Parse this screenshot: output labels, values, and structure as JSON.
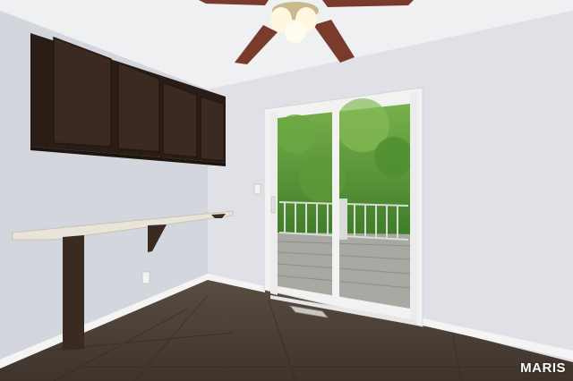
{
  "photo": {
    "watermark": "MARIS",
    "colors": {
      "ceiling": "#eef0f2",
      "wall_left": "#d3d6dc",
      "wall_back": "#dfe1e6",
      "wall_right": "#d7d9de",
      "cabinet": "#3b2a22",
      "cabinet_dark": "#2a1d17",
      "countertop": "#e9e4da",
      "floor": "#4b3f35",
      "baseboard": "#f4f4f4",
      "door_frame": "#f2f2f2",
      "foliage": "#5f9e3c",
      "deck": "#a9a9a3",
      "railing": "#d8dcd6"
    }
  }
}
